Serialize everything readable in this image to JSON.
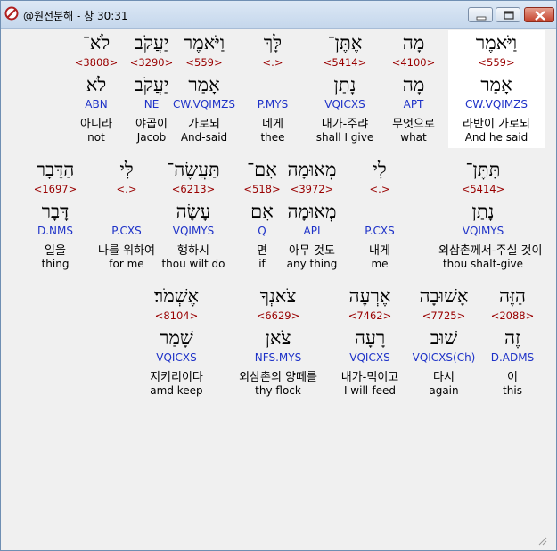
{
  "window": {
    "title": "@원전분해 - 창 30:31"
  },
  "rows": [
    [
      {
        "heb1": "וַיֹּאמֶר",
        "strong": "<559>",
        "heb2": "אָמַר",
        "parse": "CW.VQIMZS",
        "kor": "라반이 가로되",
        "eng": "And he said",
        "selected": true
      },
      {
        "heb1": "מָה",
        "strong": "<4100>",
        "heb2": "מָה",
        "parse": "APT",
        "kor": "무엇으로",
        "eng": "what"
      },
      {
        "heb1": "אֶתֶּן־",
        "strong": "<5414>",
        "heb2": "נָתַן",
        "parse": "VQICXS",
        "kor": "내가-주랴",
        "eng": "shall I give"
      },
      {
        "heb1": "לָּךְ",
        "strong": "<.>",
        "heb2": "",
        "parse": "P.MYS",
        "kor": "네게",
        "eng": "thee"
      },
      {
        "heb1": "וַיֹּאמֶר",
        "strong": "<559>",
        "heb2": "אָמַר",
        "parse": "CW.VQIMZS",
        "kor": "가로되",
        "eng": "And-said"
      },
      {
        "heb1": "יַעֲקֹב",
        "strong": "<3290>",
        "heb2": "יַעֲקֹב",
        "parse": "NE",
        "kor": "야곱이",
        "eng": "Jacob"
      },
      {
        "heb1": "לֹא־",
        "strong": "<3808>",
        "heb2": "לֹא",
        "parse": "ABN",
        "kor": "아니라",
        "eng": "not"
      }
    ],
    [
      {
        "heb1": "תִּתֶּן־",
        "strong": "<5414>",
        "heb2": "נָתַן",
        "parse": "VQIMYS",
        "kor": "외삼촌께서-주실 것이",
        "eng": "thou shalt-give"
      },
      {
        "heb1": "לִי",
        "strong": "<.>",
        "heb2": "",
        "parse": "P.CXS",
        "kor": "내게",
        "eng": "me"
      },
      {
        "heb1": "מְאוּמָה",
        "strong": "<3972>",
        "heb2": "מְאוּמָה",
        "parse": "API",
        "kor": "아무 것도",
        "eng": "any thing"
      },
      {
        "heb1": "אִם־",
        "strong": "<518>",
        "heb2": "אִם",
        "parse": "Q",
        "kor": "면",
        "eng": "if"
      },
      {
        "heb1": "תַּעֲשֶׂה־",
        "strong": "<6213>",
        "heb2": "עָשָׂה",
        "parse": "VQIMYS",
        "kor": "행하시",
        "eng": "thou wilt do"
      },
      {
        "heb1": "לִּי",
        "strong": "<.>",
        "heb2": "",
        "parse": "P.CXS",
        "kor": "나를 위하여",
        "eng": "for me"
      },
      {
        "heb1": "הַדָּבָר",
        "strong": "<1697>",
        "heb2": "דָּבָר",
        "parse": "D.NMS",
        "kor": "일을",
        "eng": "thing"
      }
    ],
    [
      {
        "heb1": "הַזֶּה",
        "strong": "<2088>",
        "heb2": "זֶה",
        "parse": "D.ADMS",
        "kor": "이",
        "eng": "this"
      },
      {
        "heb1": "אָשׁוּבָה",
        "strong": "<7725>",
        "heb2": "שׁוּב",
        "parse": "VQICXS(Ch)",
        "kor": "다시",
        "eng": "again"
      },
      {
        "heb1": "אֶרְעֶה",
        "strong": "<7462>",
        "heb2": "רָעָה",
        "parse": "VQICXS",
        "kor": "내가-먹이고",
        "eng": "I will-feed"
      },
      {
        "heb1": "צֹאנְךָ",
        "strong": "<6629>",
        "heb2": "צֹאן",
        "parse": "NFS.MYS",
        "kor": "외삼촌의 양떼를",
        "eng": "thy flock"
      },
      {
        "heb1": "אֶשְׁמֹר׃",
        "strong": "<8104>",
        "heb2": "שָׁמַר",
        "parse": "VQICXS",
        "kor": "지키리이다",
        "eng": "amd keep"
      }
    ]
  ]
}
